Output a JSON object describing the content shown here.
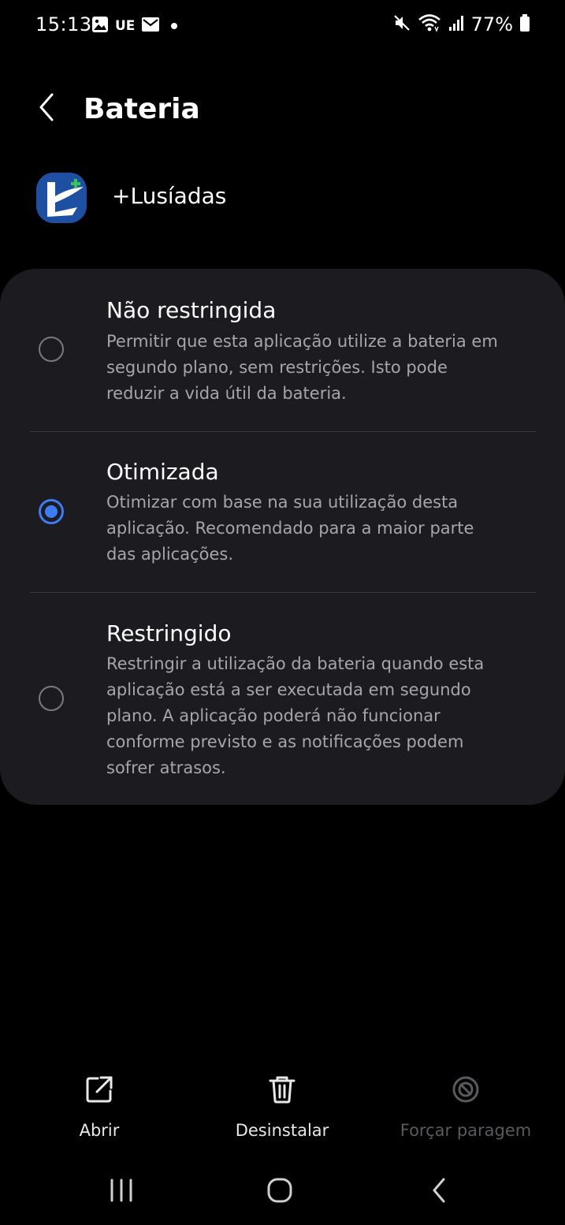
{
  "status_bar": {
    "time": "15:13",
    "carrier": "UE",
    "battery": "77%"
  },
  "header": {
    "title": "Bateria"
  },
  "app": {
    "name": "+Lusíadas"
  },
  "options": [
    {
      "title": "Não restringida",
      "description": "Permitir que esta aplicação utilize a bateria em segundo plano, sem restrições. Isto pode reduzir a vida útil da bateria.",
      "selected": false
    },
    {
      "title": "Otimizada",
      "description": "Otimizar com base na sua utilização desta aplicação. Recomendado para a maior parte das aplicações.",
      "selected": true
    },
    {
      "title": "Restringido",
      "description": "Restringir a utilização da bateria quando esta aplicação está a ser executada em segundo plano. A aplicação poderá não funcionar conforme previsto e as notificações podem sofrer atrasos.",
      "selected": false
    }
  ],
  "actions": {
    "open": "Abrir",
    "uninstall": "Desinstalar",
    "force_stop": "Forçar paragem"
  },
  "colors": {
    "accent": "#3d7cf5",
    "card": "#1c1c20",
    "background": "#000000"
  },
  "icons": {
    "status_left": [
      "image-icon",
      "mail-icon"
    ],
    "status_right": [
      "mute-icon",
      "wifi-icon",
      "signal-icon",
      "battery-icon"
    ],
    "actions": [
      "open-external-icon",
      "trash-icon",
      "block-icon"
    ],
    "nav": [
      "recent-apps-icon",
      "home-icon",
      "back-icon"
    ]
  }
}
